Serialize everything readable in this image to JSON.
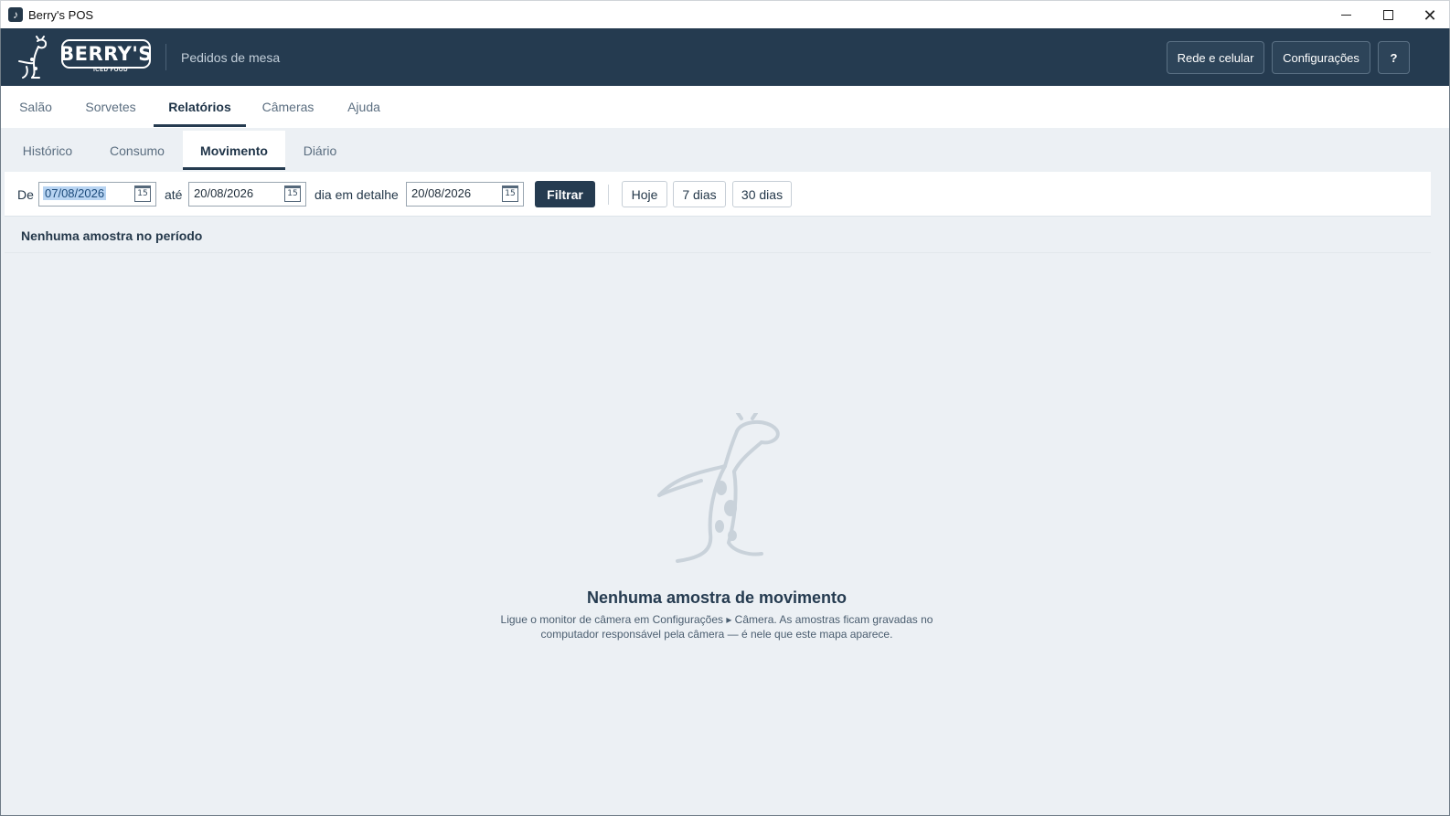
{
  "window": {
    "title": "Berry's POS"
  },
  "header": {
    "logo_text": "BERRY'S",
    "logo_subtext": "ICED FOOD",
    "subtitle": "Pedidos de mesa",
    "buttons": {
      "network": "Rede e celular",
      "settings": "Configurações",
      "help": "?"
    }
  },
  "main_tabs": [
    {
      "label": "Salão"
    },
    {
      "label": "Sorvetes"
    },
    {
      "label": "Relatórios",
      "active": true
    },
    {
      "label": "Câmeras"
    },
    {
      "label": "Ajuda"
    }
  ],
  "sub_tabs": [
    {
      "label": "Histórico"
    },
    {
      "label": "Consumo"
    },
    {
      "label": "Movimento",
      "active": true
    },
    {
      "label": "Diário"
    }
  ],
  "filter": {
    "from_label": "De",
    "from_value": "07/08/2026",
    "to_label": "até",
    "to_value": "20/08/2026",
    "detail_label": "dia em detalhe",
    "detail_value": "20/08/2026",
    "calendar_glyph": "15",
    "filter_button": "Filtrar",
    "quick_ranges": [
      "Hoje",
      "7 dias",
      "30 dias"
    ]
  },
  "status": {
    "no_sample_period": "Nenhuma amostra no período"
  },
  "empty_state": {
    "title": "Nenhuma amostra de movimento",
    "description_line1": "Ligue o monitor de câmera em Configurações ▸ Câmera. As amostras ficam gravadas no",
    "description_line2": "computador responsável pela câmera — é nele que este mapa aparece."
  },
  "colors": {
    "header_bg": "#253b50",
    "content_bg": "#ecf0f4",
    "accent": "#253b50"
  }
}
